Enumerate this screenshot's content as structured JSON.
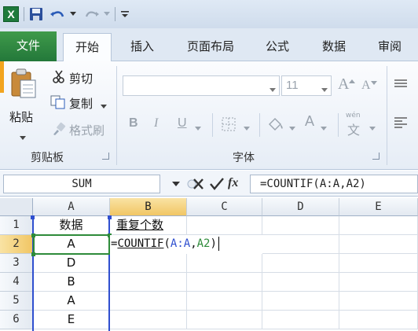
{
  "app": {
    "logo_letter": "X"
  },
  "ribbon_tabs": [
    {
      "label": "文件"
    },
    {
      "label": "开始"
    },
    {
      "label": "插入"
    },
    {
      "label": "页面布局"
    },
    {
      "label": "公式"
    },
    {
      "label": "数据"
    },
    {
      "label": "审阅"
    }
  ],
  "clipboard": {
    "paste_label": "粘贴",
    "cut_label": "剪切",
    "copy_label": "复制",
    "format_painter_label": "格式刷",
    "group_label": "剪贴板"
  },
  "font": {
    "font_name_value": "",
    "font_size_value": "11",
    "bold": "B",
    "italic": "I",
    "underline": "U",
    "font_color_letter": "A",
    "grow_letter": "A",
    "shrink_letter": "A",
    "wen_glyph": "wén",
    "wen_char": "文",
    "group_label": "字体"
  },
  "formula_bar": {
    "name_box": "SUM",
    "fx": "fx",
    "formula": "=COUNTIF(A:A,A2)"
  },
  "sheet": {
    "columns": [
      "A",
      "B",
      "C",
      "D",
      "E"
    ],
    "rows": [
      "1",
      "2",
      "3",
      "4",
      "5",
      "6"
    ],
    "cells": {
      "A1": "数据",
      "B1": "重复个数",
      "A2": "A",
      "A3": "D",
      "A4": "B",
      "A5": "A",
      "A6": "E"
    },
    "edit_cell": {
      "eq": "=",
      "fn": "COUNTIF",
      "open": "(",
      "arg1": "A:A",
      "comma": ",",
      "arg2": "A2",
      "close": ")"
    }
  },
  "colors": {
    "file_tab": "#2f8a43",
    "range_highlight_blue": "#2f4fcf",
    "range_highlight_green": "#2e8b3a",
    "selected_header": "#f1c664"
  }
}
